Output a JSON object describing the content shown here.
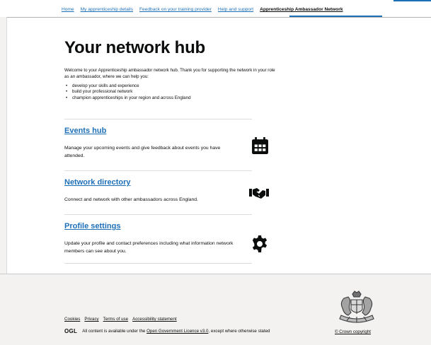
{
  "nav": {
    "items": [
      {
        "label": "Home",
        "active": false
      },
      {
        "label": "My apprenticeship details",
        "active": false
      },
      {
        "label": "Feedback on your training provider",
        "active": false
      },
      {
        "label": "Help and support",
        "active": false
      },
      {
        "label": "Apprenticeship Ambassador Network",
        "active": true
      }
    ]
  },
  "page": {
    "title": "Your network hub",
    "intro": "Welcome to your Apprenticeship ambassador network hub. Thank you for supporting the network in your role as an ambassador, where we can help you:",
    "bullets": [
      "develop your skills and experience",
      "build your professional network",
      "champion apprenticeships in your region and across England"
    ]
  },
  "cards": [
    {
      "title": "Events hub",
      "description": "Manage your upcoming events and give feedback about events you have attended.",
      "icon": "calendar-icon"
    },
    {
      "title": "Network directory",
      "description": "Connect and network with other ambassadors across England.",
      "icon": "handshake-icon"
    },
    {
      "title": "Profile settings",
      "description": "Update your profile and contact preferences including what information network members can see about you.",
      "icon": "gear-icon"
    }
  ],
  "footer": {
    "links": [
      "Cookies",
      "Privacy",
      "Terms of use",
      "Accessibility statement"
    ],
    "ogl_logo": "OGL",
    "licence_prefix": "All content is available under the",
    "licence_link": "Open Government Licence v3.0",
    "licence_suffix": ", except where otherwise stated",
    "copyright": "© Crown copyright",
    "crest_icon": "royal-coat-of-arms-icon"
  },
  "colors": {
    "link": "#1d70b8",
    "text": "#0b0c0c",
    "footer_bg": "#f3f2f1"
  }
}
